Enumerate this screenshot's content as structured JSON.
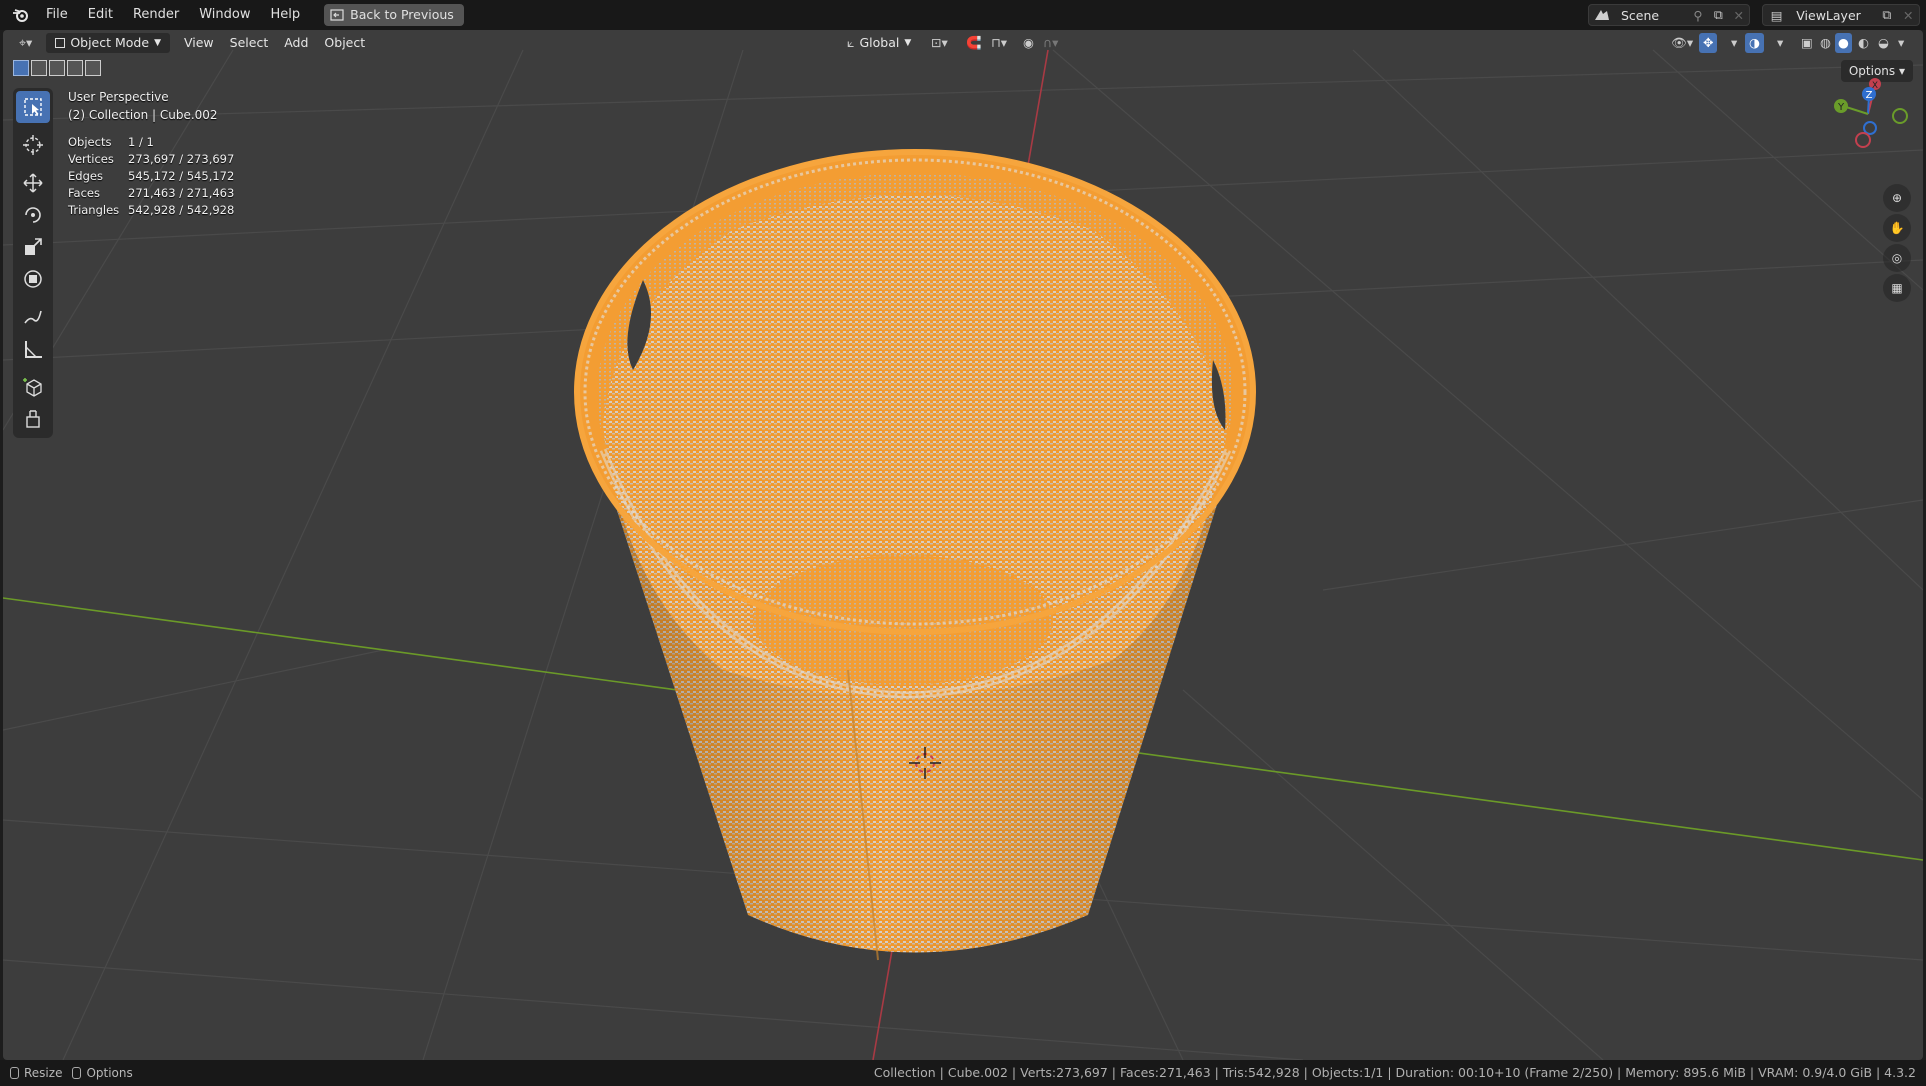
{
  "topbar": {
    "menu": [
      "File",
      "Edit",
      "Render",
      "Window",
      "Help"
    ],
    "back_button": "Back to Previous",
    "scene_name": "Scene",
    "view_layer": "ViewLayer"
  },
  "header": {
    "mode": "Object Mode",
    "menus": [
      "View",
      "Select",
      "Add",
      "Object"
    ],
    "orientation": "Global",
    "options": "Options"
  },
  "overlay": {
    "perspective": "User Perspective",
    "collection": "(2) Collection | Cube.002",
    "stats": [
      {
        "label": "Objects",
        "value": "1 / 1"
      },
      {
        "label": "Vertices",
        "value": "273,697 / 273,697"
      },
      {
        "label": "Edges",
        "value": "545,172 / 545,172"
      },
      {
        "label": "Faces",
        "value": "271,463 / 271,463"
      },
      {
        "label": "Triangles",
        "value": "542,928 / 542,928"
      }
    ]
  },
  "gizmo": {
    "x": "X",
    "y": "Y",
    "z": "Z"
  },
  "statusbar": {
    "left_resize": "Resize",
    "left_options": "Options",
    "info": "Collection | Cube.002 | Verts:273,697 | Faces:271,463 | Tris:542,928 | Objects:1/1 | Duration: 00:10+10 (Frame 2/250) | Memory: 895.6 MiB | VRAM: 0.9/4.0 GiB | 4.3.2"
  },
  "colors": {
    "accent": "#4772b3",
    "selection": "#f5a03b",
    "x_axis": "#c3404f",
    "y_axis": "#6a9c2a",
    "z_axis": "#2f6fd0"
  }
}
